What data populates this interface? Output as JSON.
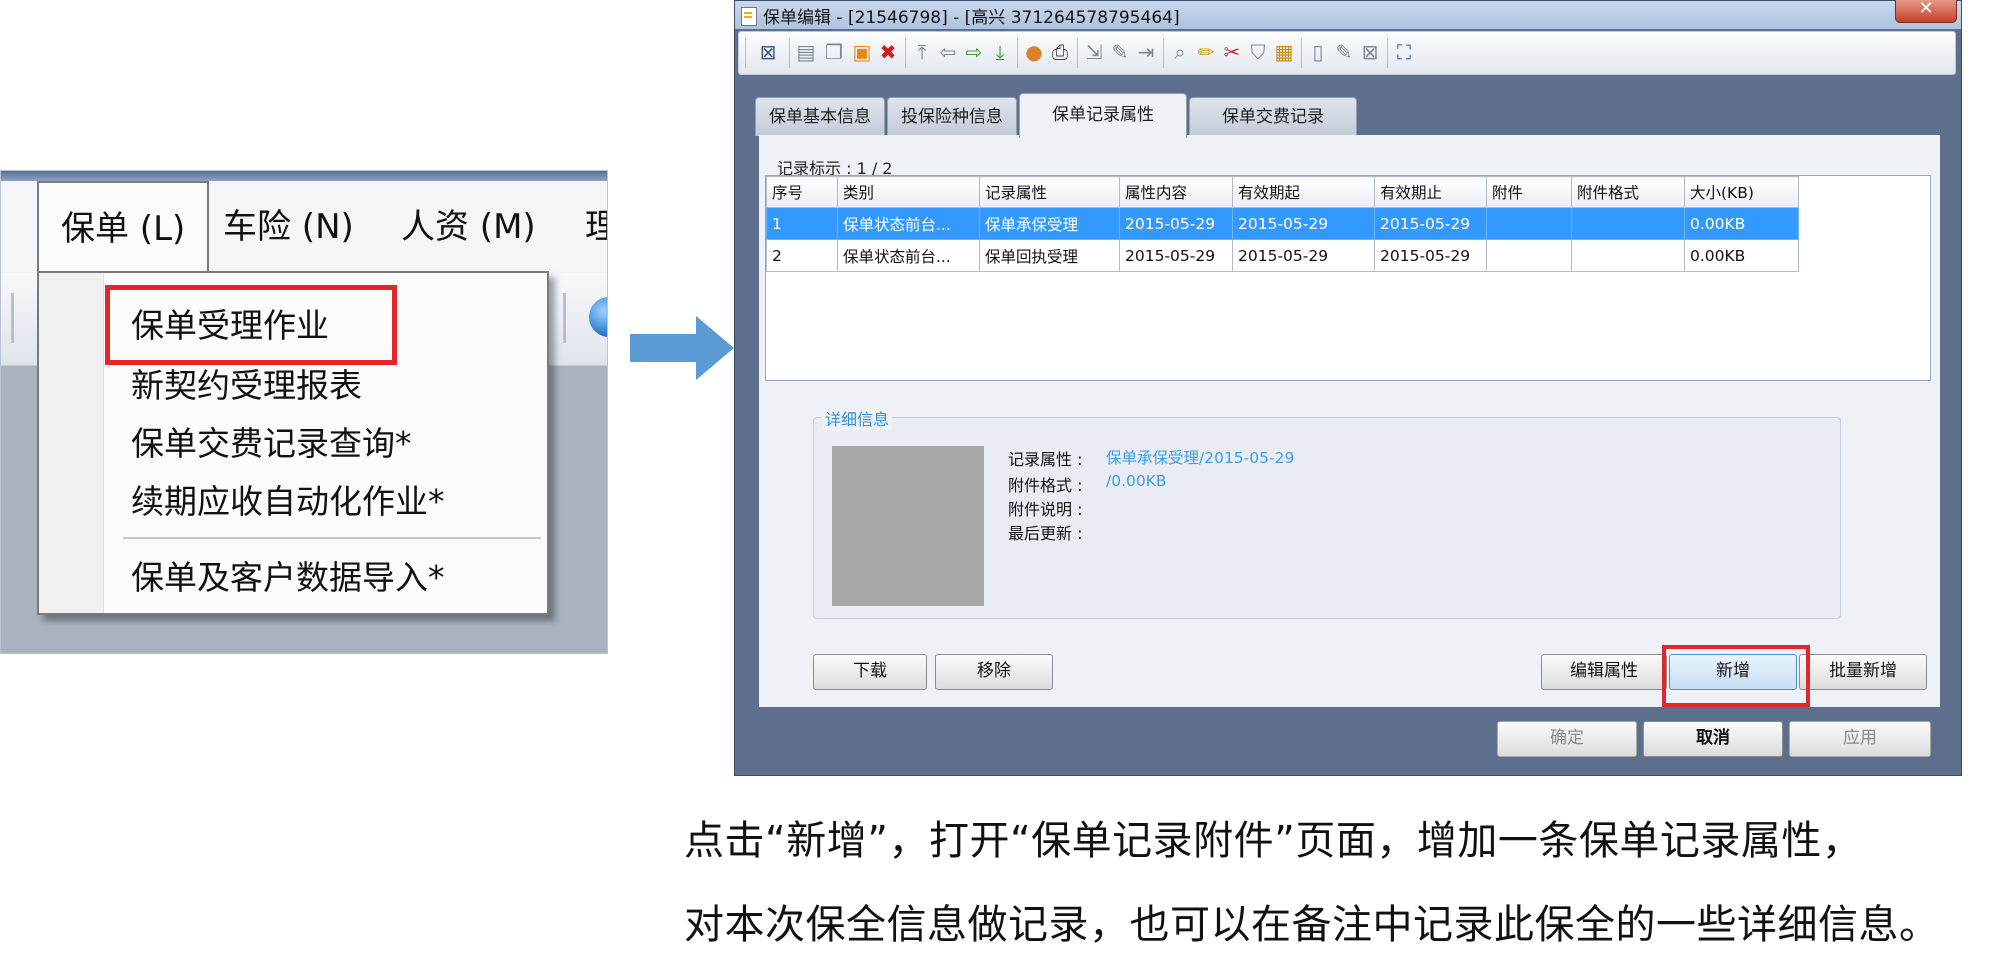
{
  "menu_screenshot": {
    "menubar": [
      "保单 (L)",
      "车险 (N)",
      "人资 (M)",
      "理"
    ],
    "dropdown_items": [
      "保单受理作业",
      "新契约受理报表",
      "保单交费记录查询*",
      "续期应收自动化作业*",
      "保单及客户数据导入*"
    ],
    "highlighted_item": "保单受理作业"
  },
  "dialog": {
    "title": "保单编辑 - [21546798] - [高兴 371264578795464]",
    "tabs": [
      "保单基本信息",
      "投保险种信息",
      "保单记录属性",
      "保单交费记录"
    ],
    "active_tab": "保单记录属性",
    "record_indicator": "记录标示 : 1 / 2",
    "table": {
      "columns": [
        "序号",
        "类别",
        "记录属性",
        "属性内容",
        "有效期起",
        "有效期止",
        "附件",
        "附件格式",
        "大小(KB)"
      ],
      "rows": [
        [
          "1",
          "保单状态前台...",
          "保单承保受理",
          "2015-05-29",
          "2015-05-29",
          "2015-05-29",
          "",
          "",
          "0.00KB"
        ],
        [
          "2",
          "保单状态前台...",
          "保单回执受理",
          "2015-05-29",
          "2015-05-29",
          "2015-05-29",
          "",
          "",
          "0.00KB"
        ]
      ],
      "selected_row": 1
    },
    "detail": {
      "legend": "详细信息",
      "record_attr_label": "记录属性 :",
      "record_attr_value": "保单承保受理/2015-05-29",
      "attach_format_label": "附件格式 :",
      "attach_format_value": "/0.00KB",
      "attach_desc_label": "附件说明 :",
      "last_update_label": "最后更新 :"
    },
    "buttons": {
      "download": "下载",
      "remove": "移除",
      "edit_attr": "编辑属性",
      "add": "新增",
      "batch_add": "批量新增",
      "ok": "确定",
      "cancel": "取消",
      "apply": "应用"
    }
  },
  "caption": [
    "点击“新增”，打开“保单记录附件”页面，增加一条保单记录属性，",
    "对本次保全信息做记录，也可以在备注中记录此保全的一些详细信息。"
  ],
  "colors": {
    "highlight_red": "#e4262c",
    "arrow_blue": "#5b9bd5",
    "selection_blue": "#3399ff"
  }
}
